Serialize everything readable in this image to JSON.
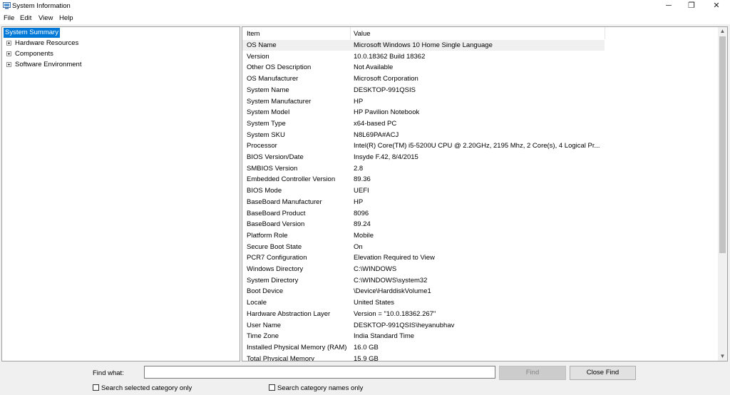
{
  "window": {
    "title": "System Information",
    "icon": "system-information-icon"
  },
  "window_controls": {
    "minimize": "─",
    "restore": "❐",
    "close": "✕"
  },
  "menu": [
    "File",
    "Edit",
    "View",
    "Help"
  ],
  "tree": [
    {
      "label": "System Summary",
      "selected": true,
      "expandable": false
    },
    {
      "label": "Hardware Resources",
      "expandable": true
    },
    {
      "label": "Components",
      "expandable": true
    },
    {
      "label": "Software Environment",
      "expandable": true
    }
  ],
  "table": {
    "headers": {
      "item": "Item",
      "value": "Value"
    },
    "rows": [
      {
        "item": "OS Name",
        "value": "Microsoft Windows 10 Home Single Language"
      },
      {
        "item": "Version",
        "value": "10.0.18362 Build 18362"
      },
      {
        "item": "Other OS Description",
        "value": "Not Available"
      },
      {
        "item": "OS Manufacturer",
        "value": "Microsoft Corporation"
      },
      {
        "item": "System Name",
        "value": "DESKTOP-991QSIS"
      },
      {
        "item": "System Manufacturer",
        "value": "HP"
      },
      {
        "item": "System Model",
        "value": "HP Pavilion Notebook"
      },
      {
        "item": "System Type",
        "value": "x64-based PC"
      },
      {
        "item": "System SKU",
        "value": "N8L69PA#ACJ"
      },
      {
        "item": "Processor",
        "value": "Intel(R) Core(TM) i5-5200U CPU @ 2.20GHz, 2195 Mhz, 2 Core(s), 4 Logical Pr..."
      },
      {
        "item": "BIOS Version/Date",
        "value": "Insyde F.42, 8/4/2015"
      },
      {
        "item": "SMBIOS Version",
        "value": "2.8"
      },
      {
        "item": "Embedded Controller Version",
        "value": "89.36"
      },
      {
        "item": "BIOS Mode",
        "value": "UEFI"
      },
      {
        "item": "BaseBoard Manufacturer",
        "value": "HP"
      },
      {
        "item": "BaseBoard Product",
        "value": "8096"
      },
      {
        "item": "BaseBoard Version",
        "value": "89.24"
      },
      {
        "item": "Platform Role",
        "value": "Mobile"
      },
      {
        "item": "Secure Boot State",
        "value": "On"
      },
      {
        "item": "PCR7 Configuration",
        "value": "Elevation Required to View"
      },
      {
        "item": "Windows Directory",
        "value": "C:\\WINDOWS"
      },
      {
        "item": "System Directory",
        "value": "C:\\WINDOWS\\system32"
      },
      {
        "item": "Boot Device",
        "value": "\\Device\\HarddiskVolume1"
      },
      {
        "item": "Locale",
        "value": "United States"
      },
      {
        "item": "Hardware Abstraction Layer",
        "value": "Version = \"10.0.18362.267\""
      },
      {
        "item": "User Name",
        "value": "DESKTOP-991QSIS\\heyanubhav"
      },
      {
        "item": "Time Zone",
        "value": "India Standard Time"
      },
      {
        "item": "Installed Physical Memory (RAM)",
        "value": "16.0 GB"
      },
      {
        "item": "Total Physical Memory",
        "value": "15.9 GB"
      }
    ]
  },
  "find": {
    "label": "Find what:",
    "value": "",
    "find_button": "Find",
    "close_find_button": "Close Find",
    "check_selected": "Search selected category only",
    "check_names": "Search category names only"
  },
  "colors": {
    "selection": "#0078d7",
    "background": "#f0f0f0"
  }
}
